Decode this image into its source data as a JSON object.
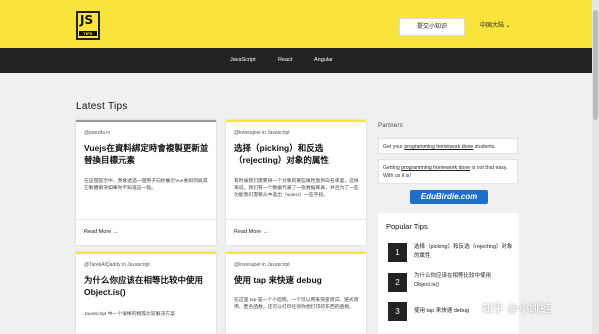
{
  "header": {
    "logo_text": "JS",
    "logo_sub": "TIPS",
    "submit_label": "提交小知识",
    "language_label": "中国大陆 ⌄"
  },
  "nav": {
    "items": [
      "JavaScript",
      "React",
      "Angular"
    ]
  },
  "main": {
    "section_title": "Latest Tips",
    "read_more": "Read More →",
    "cards": [
      {
        "meta": "@panzila in",
        "title": "Vuejs在資料綁定時會複製更新並替換目標元素",
        "desc": "在這個提示中，我會透過一個例子向你展示Vue會如何與其它軟體衝突如果你不知道這一點。"
      },
      {
        "meta": "@loverajoel in Javascript",
        "title": "选择（picking）和反选（rejecting）对象的属性",
        "desc": "有时候我们需要将一个对象的某些属性放到白名单里，这样来说，我们有一个数据代表了一张数据库表，并且为了一些功能我们需要从中选出（select）一些字段。"
      },
      {
        "meta": "@TarekAlQaddy in Javascript",
        "title": "为什么你应该在相等比较中使用 Object.is()",
        "desc": "JavaScript 中一个很棒的相等比较解决方案"
      },
      {
        "meta": "@loverajoel in Javascript",
        "title": "使用 tap 来快速 debug",
        "desc": "在这里 tap 是一个小怪物，一个可以用来快速调试、链式调用、匿名函数，还可以打印任何你想打印的东西的函数。"
      }
    ]
  },
  "sidebar": {
    "partners_title": "Partners",
    "partner_boxes": [
      {
        "before": "Get your ",
        "link": "programming homework done",
        "after": " students."
      },
      {
        "before": "Getting ",
        "link": "programming homework done",
        "after": " is not that easy. With us it is!"
      }
    ],
    "partner_logo": "EduBirdie.com",
    "popular_title": "Popular Tips",
    "popular": [
      {
        "num": "1",
        "text": "选择（picking）和反选（rejecting）对象的属性"
      },
      {
        "num": "2",
        "text": "为什么你应该在相等比较中使用 Object.is()"
      },
      {
        "num": "3",
        "text": "使用 tap 来快速 debug"
      }
    ]
  },
  "watermark": "知乎 @小跳蛙",
  "colors": {
    "brand_yellow": "#f8e43b",
    "nav_dark": "#222222",
    "background": "#f0f0f0"
  }
}
